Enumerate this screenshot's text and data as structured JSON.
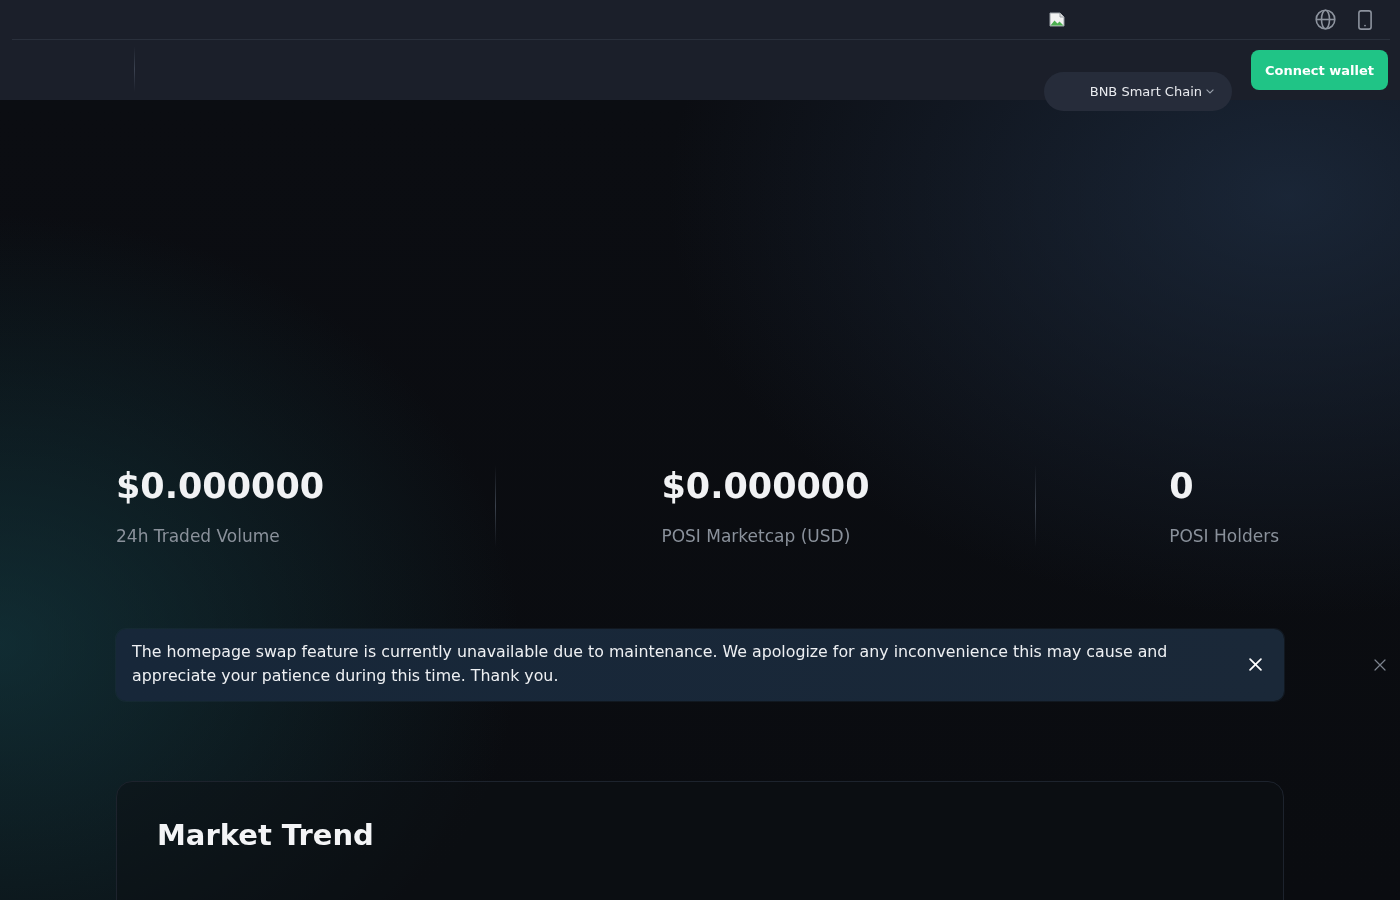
{
  "header": {
    "chain_selector": {
      "label": "BNB Smart Chain"
    },
    "connect_button": {
      "label": "Connect wallet"
    }
  },
  "stats": [
    {
      "value": "$0.000000",
      "label": "24h Traded Volume"
    },
    {
      "value": "$0.000000",
      "label": "POSI Marketcap (USD)"
    },
    {
      "value": "0",
      "label": "POSI Holders"
    }
  ],
  "notice": {
    "message": "The homepage swap feature is currently unavailable due to maintenance. We apologize for any inconvenience this may cause and appreciate your patience during this time. Thank you."
  },
  "market_trend": {
    "title": "Market Trend"
  }
}
